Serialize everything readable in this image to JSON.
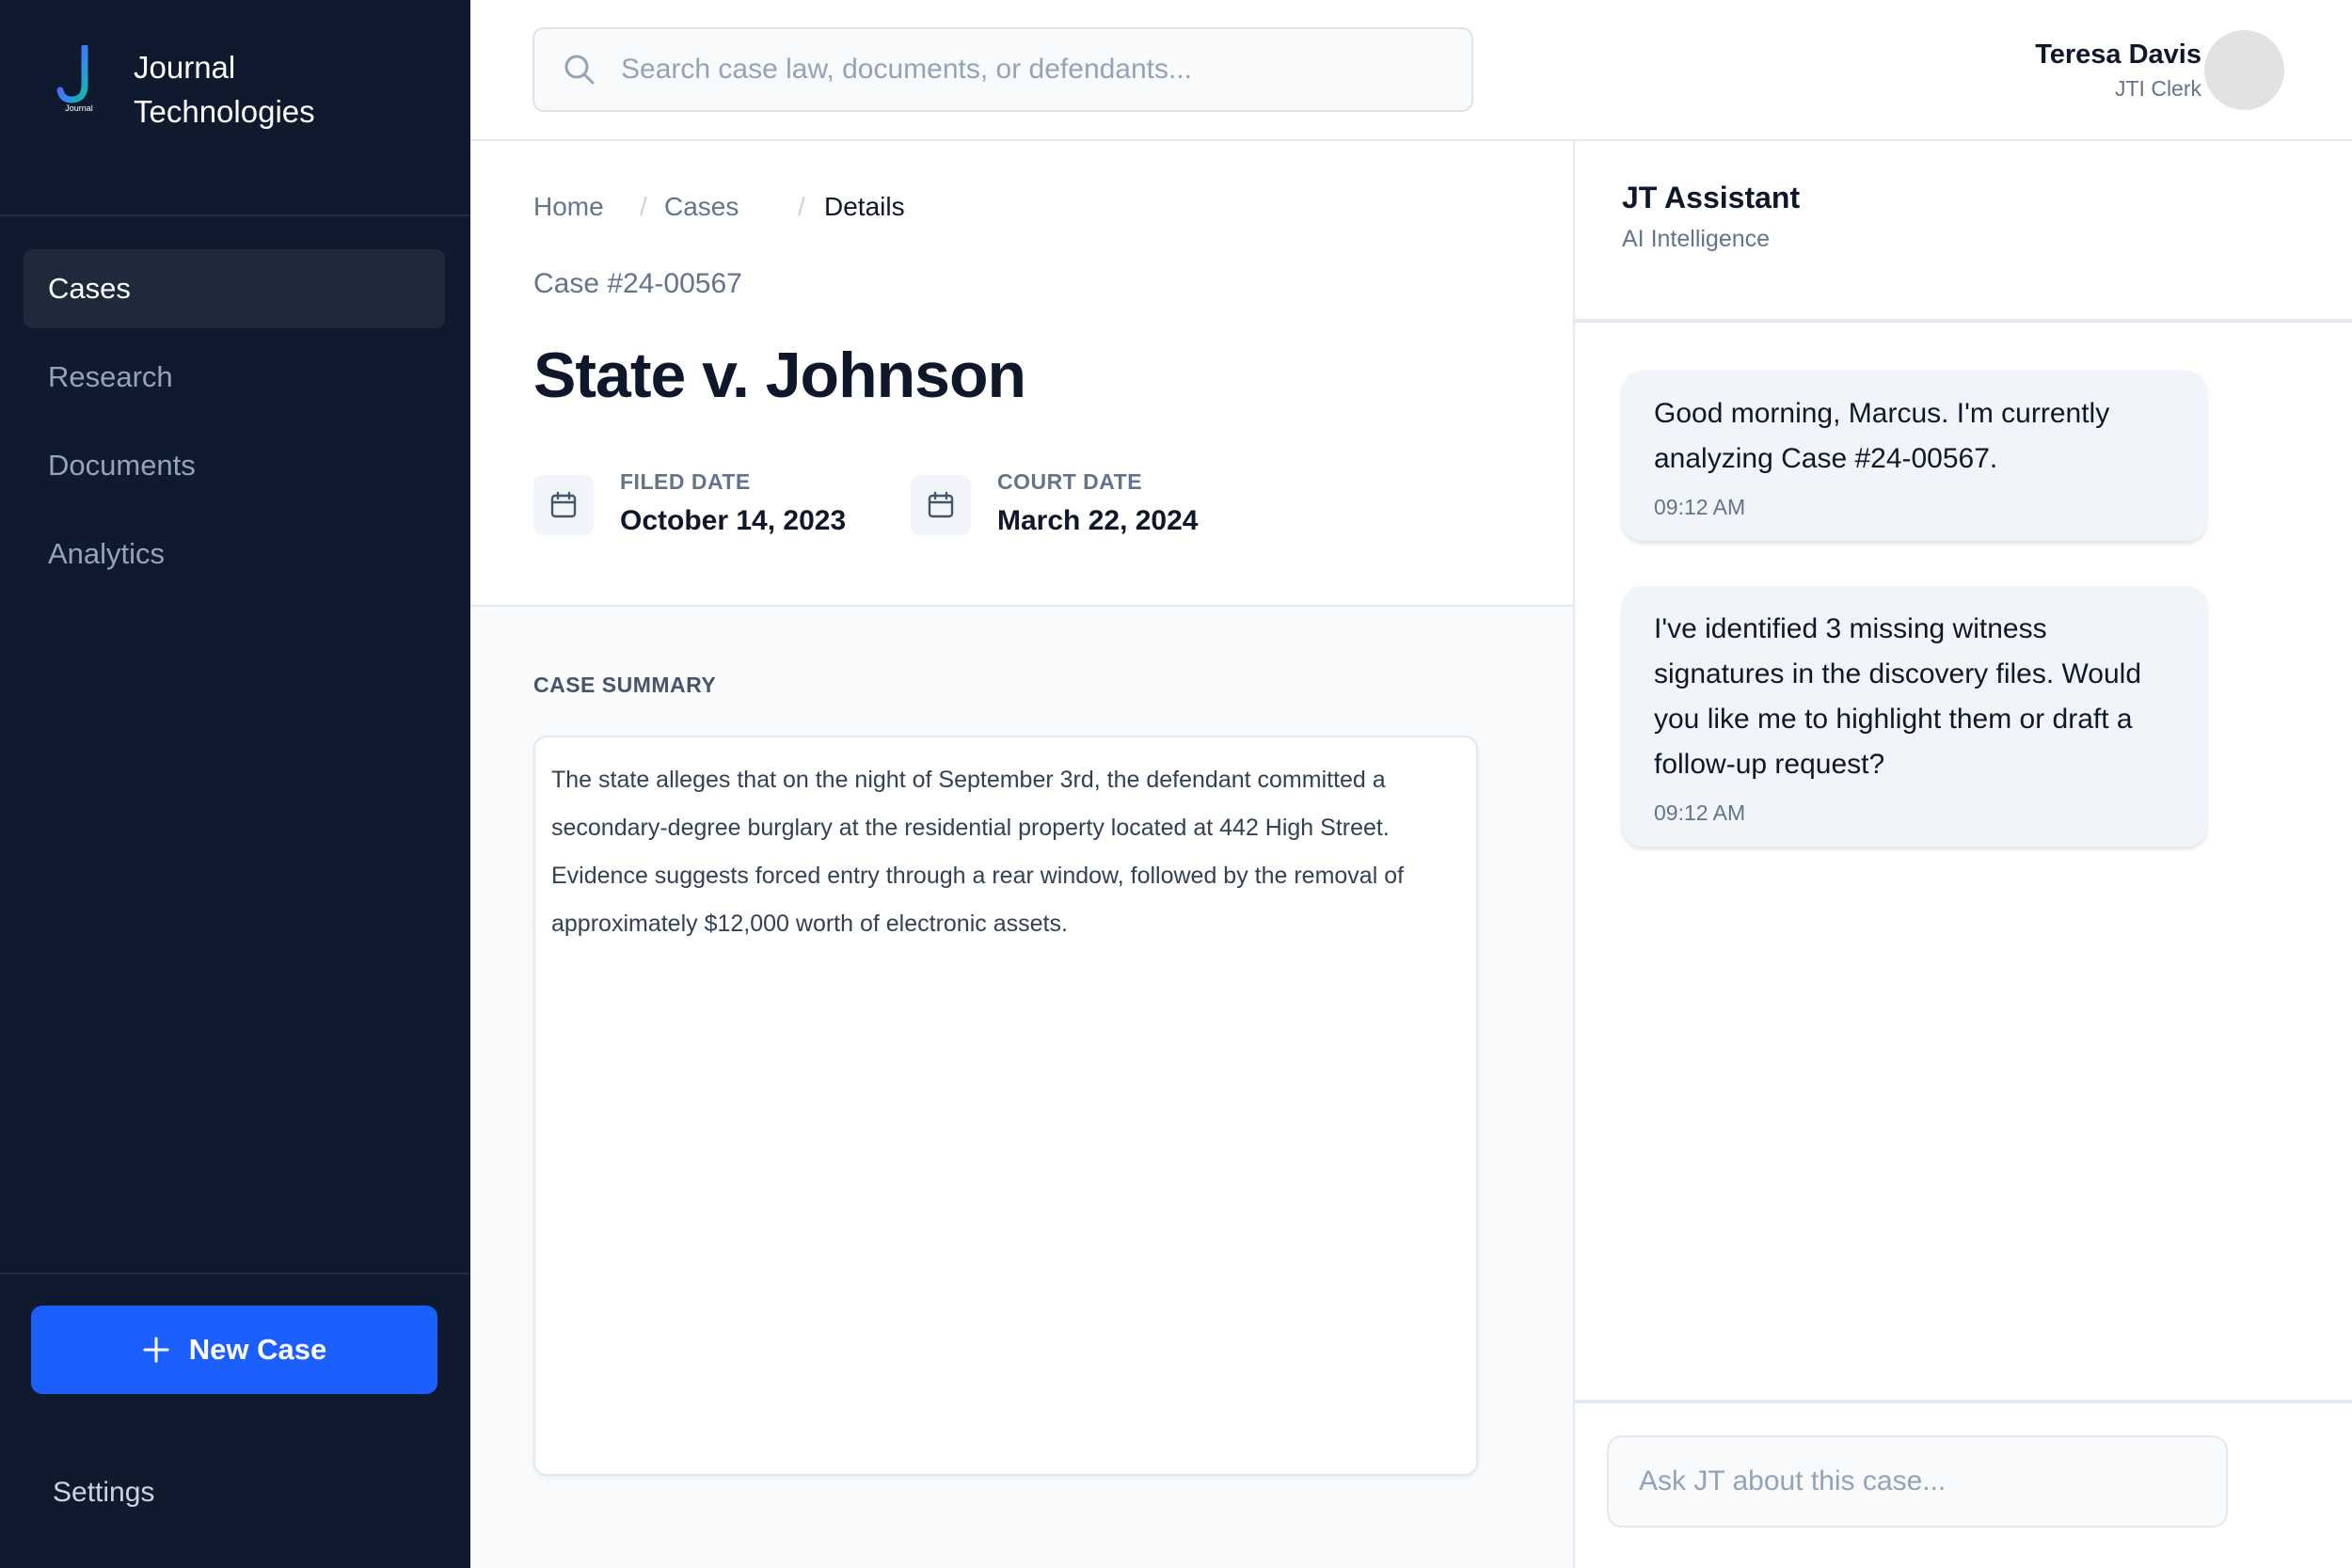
{
  "brand": {
    "name": "Journal Technologies",
    "logo_text": "Journal"
  },
  "sidebar": {
    "items": [
      {
        "label": "Cases",
        "active": true
      },
      {
        "label": "Research",
        "active": false
      },
      {
        "label": "Documents",
        "active": false
      },
      {
        "label": "Analytics",
        "active": false
      }
    ],
    "new_case_label": "New Case",
    "settings_label": "Settings"
  },
  "header": {
    "search_placeholder": "Search case law, documents, or defendants...",
    "user_name": "Teresa Davis",
    "user_role": "JTI Clerk"
  },
  "breadcrumb": {
    "items": [
      "Home",
      "Cases",
      "Details"
    ],
    "separator": "/"
  },
  "case": {
    "number": "Case #24-00567",
    "title": "State v. Johnson",
    "filed_label": "FILED DATE",
    "filed_date": "October 14, 2023",
    "court_label": "COURT DATE",
    "court_date": "March 22, 2024",
    "summary_heading": "CASE SUMMARY",
    "summary": "The state alleges that on the night of September 3rd, the defendant committed a secondary-degree burglary at the residential property located at 442 High Street. Evidence suggests forced entry through a rear window, followed by the removal of approximately $12,000 worth of electronic assets."
  },
  "assistant": {
    "title": "JT Assistant",
    "subtitle": "AI Intelligence",
    "messages": [
      {
        "text": "Good morning, Marcus. I'm currently analyzing Case #24-00567.",
        "time": "09:12 AM"
      },
      {
        "text": "I've identified 3 missing witness signatures in the discovery files. Would you like me to highlight them or draft a follow-up request?",
        "time": "09:12 AM"
      }
    ],
    "input_placeholder": "Ask JT about this case..."
  },
  "colors": {
    "sidebar_bg": "#0f1a2e",
    "accent": "#1b60ff",
    "bubble_bg": "#f1f5f9"
  },
  "icons": {
    "search": "search-icon",
    "calendar": "calendar-icon",
    "plus": "plus-icon"
  }
}
